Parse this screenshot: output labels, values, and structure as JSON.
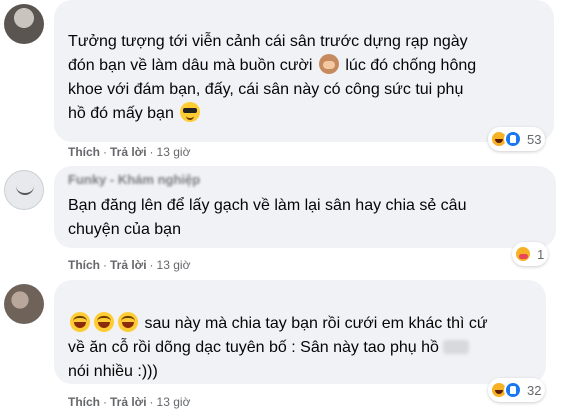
{
  "comments": [
    {
      "lines": [
        "Tưởng tượng tới viễn cảnh cái sân trước dựng rạp ngày",
        "đón bạn về làm dâu mà buồn cười",
        "lúc đó chống hông",
        "khoe với đám bạn, đấy, cái sân này có công sức tui phụ",
        "hồ đó mấy bạn"
      ],
      "emoji_after_line2": "see-no-evil-monkey-icon",
      "emoji_after_line5": "sunglasses-face-icon",
      "actions": {
        "like": "Thích",
        "reply": "Trả lời",
        "time": "13 giờ"
      },
      "reaction_count": "53",
      "reaction_icons": [
        "haha-icon",
        "like-icon"
      ]
    },
    {
      "author_partial": "Funky - Khám nghiệp",
      "lines": [
        "Bạn đăng lên để lấy gạch về làm lại sân hay chia sẻ câu",
        "chuyện của bạn"
      ],
      "actions": {
        "like": "Thích",
        "reply": "Trả lời",
        "time": "13 giờ"
      },
      "reaction_count": "1",
      "reaction_icons": [
        "care-icon"
      ]
    },
    {
      "lines": [
        "sau này mà chia tay bạn rồi cưới em khác thì cứ",
        "về ăn cỗ rồi dõng dạc tuyên bố : Sân này tao phụ hồ",
        "nói nhiều :)))"
      ],
      "emoji_prefix": [
        "laughing-face-icon",
        "laughing-face-icon",
        "laughing-face-icon"
      ],
      "actions": {
        "like": "Thích",
        "reply": "Trả lời",
        "time": "13 giờ"
      },
      "reaction_count": "32",
      "reaction_icons": [
        "haha-icon",
        "like-icon"
      ]
    }
  ],
  "colors": {
    "bubble": "#f0f2f5",
    "meta": "#65676b",
    "text": "#050505"
  }
}
